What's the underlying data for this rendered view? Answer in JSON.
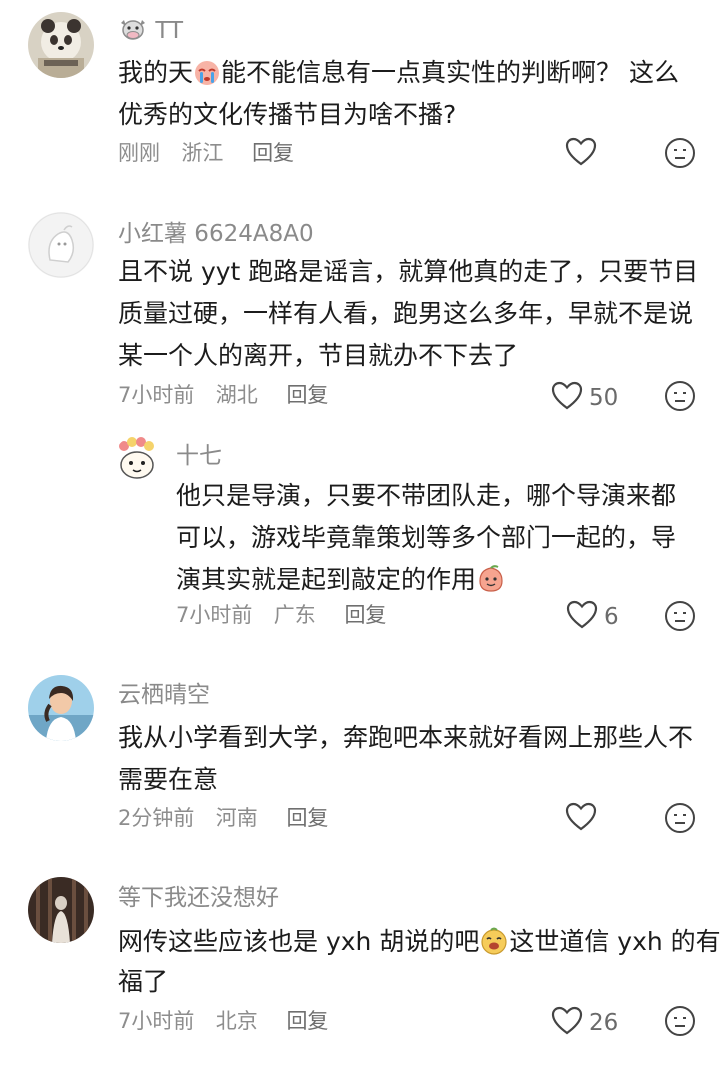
{
  "comments": [
    {
      "username": "TT",
      "line1": "我的天",
      "line1b": "能不能信息有一点真实性的判断啊？ 这么",
      "line2": "优秀的文化传播节目为啥不播?",
      "time": "刚刚",
      "location": "浙江",
      "reply": "回复",
      "likes": ""
    },
    {
      "username": "小红薯 6624A8A0",
      "line1": "且不说 yyt 跑路是谣言，就算他真的走了，只要节目",
      "line2": "质量过硬，一样有人看，跑男这么多年，早就不是说",
      "line3": "某一个人的离开，节目就办不下去了",
      "time": "7小时前",
      "location": "湖北",
      "reply": "回复",
      "likes": "50"
    },
    {
      "username": "十七",
      "line1": "他只是导演，只要不带团队走，哪个导演来都",
      "line2": "可以，游戏毕竟靠策划等多个部门一起的，导",
      "line3": "演其实就是起到敲定的作用",
      "time": "7小时前",
      "location": "广东",
      "reply": "回复",
      "likes": "6"
    },
    {
      "username": "云栖晴空",
      "line1": "我从小学看到大学，奔跑吧本来就好看网上那些人不",
      "line2": "需要在意",
      "time": "2分钟前",
      "location": "河南",
      "reply": "回复",
      "likes": ""
    },
    {
      "username": "等下我还没想好",
      "line1": "网传这些应该也是 yxh 胡说的吧",
      "line1b": "这世道信 yxh 的有",
      "line2": "福了",
      "time": "7小时前",
      "location": "北京",
      "reply": "回复",
      "likes": "26"
    }
  ],
  "icons": {
    "like": "heart-outline-icon",
    "dislike": "neutral-face-icon",
    "username_badge": "cow-icon"
  },
  "colors": {
    "text": "#1c1c1c",
    "meta": "#8d8d8d",
    "username": "#8a8a8a"
  }
}
